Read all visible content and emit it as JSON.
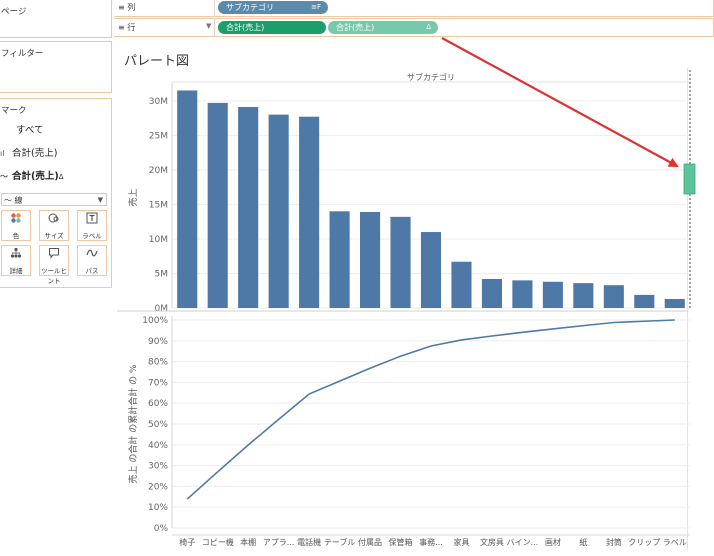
{
  "sidebar": {
    "pages_title": "ページ",
    "filters_title": "フィルター",
    "marks": {
      "title": "マーク",
      "items": [
        {
          "icon": "",
          "label": "すべて"
        },
        {
          "icon": "ıl",
          "label": "合計(売上)"
        },
        {
          "icon": "〜",
          "label": "合計(売上)",
          "delta": "Δ"
        }
      ],
      "mark_type": {
        "icon": "〜",
        "value": "線"
      },
      "buttons": [
        {
          "name": "color",
          "label": "色"
        },
        {
          "name": "size",
          "label": "サイズ"
        },
        {
          "name": "label",
          "label": "ラベル"
        },
        {
          "name": "detail",
          "label": "詳細"
        },
        {
          "name": "tooltip",
          "label": "ツールヒント"
        },
        {
          "name": "path",
          "label": "パス"
        }
      ]
    }
  },
  "shelves": {
    "columns": {
      "icon": "≡",
      "label": "列",
      "pills": [
        {
          "label": "サブカテゴリ",
          "icon": "≡F",
          "color": "#5b8bab"
        }
      ]
    },
    "rows": {
      "icon": "≡",
      "label": "行",
      "pills": [
        {
          "label": "合計(売上)",
          "icon": "",
          "color": "#1c9e6b"
        },
        {
          "label": "合計(売上)",
          "icon": "Δ",
          "color": "#78c9a9"
        }
      ]
    }
  },
  "sheet": {
    "title": "パレート図"
  },
  "colors": {
    "bar": "#4e79a7",
    "line": "#4e79a7",
    "annotation": "#e03030",
    "drop_zone": "#5dc39b"
  },
  "chart_data": [
    {
      "type": "bar",
      "header": "サブカテゴリ",
      "ylabel": "売上",
      "categories": [
        "椅子",
        "コピー機",
        "本棚",
        "アプラ...",
        "電話機",
        "テーブル",
        "付属品",
        "保管箱",
        "事務...",
        "家具",
        "文房具",
        "バイン...",
        "画材",
        "紙",
        "封筒",
        "クリップ",
        "ラベル"
      ],
      "values": [
        31.5,
        29.7,
        29.1,
        28.0,
        27.7,
        14.0,
        13.9,
        13.2,
        11.0,
        6.7,
        4.2,
        4.0,
        3.8,
        3.6,
        3.3,
        1.9,
        1.3
      ],
      "unit": "M",
      "ylim": [
        0,
        32
      ],
      "yticks": [
        "0M",
        "5M",
        "10M",
        "15M",
        "20M",
        "25M",
        "30M"
      ]
    },
    {
      "type": "line",
      "ylabel": "売上 の合計 の累計合計 の %",
      "categories": [
        "椅子",
        "コピー機",
        "本棚",
        "アプラ...",
        "電話機",
        "テーブル",
        "付属品",
        "保管箱",
        "事務...",
        "家具",
        "文房具",
        "バイン...",
        "画材",
        "紙",
        "封筒",
        "クリップ",
        "ラベル"
      ],
      "values": [
        13.9,
        27.0,
        39.9,
        52.2,
        64.4,
        70.6,
        76.8,
        82.6,
        87.5,
        90.4,
        92.3,
        94.1,
        95.7,
        97.3,
        98.8,
        99.4,
        100.0
      ],
      "ylim": [
        0,
        100
      ],
      "yticks": [
        "0%",
        "10%",
        "20%",
        "30%",
        "40%",
        "50%",
        "60%",
        "70%",
        "80%",
        "90%",
        "100%"
      ]
    }
  ]
}
